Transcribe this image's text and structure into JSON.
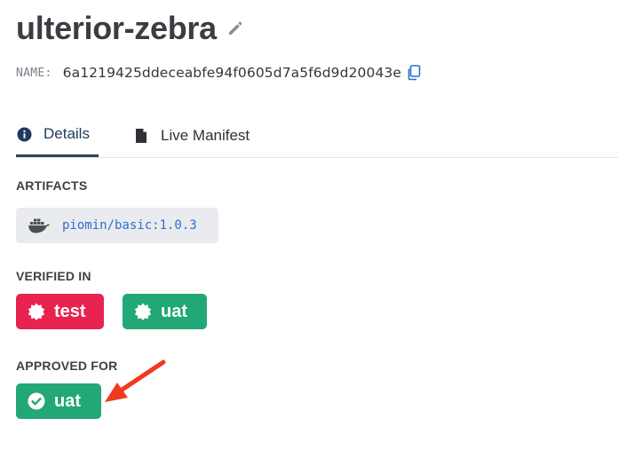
{
  "header": {
    "title": "ulterior-zebra",
    "name_label": "NAME:",
    "name_value": "6a1219425ddeceabfe94f0605d7a5f6d9d20043e"
  },
  "tabs": [
    {
      "label": "Details",
      "icon": "info-circle-icon",
      "active": true
    },
    {
      "label": "Live Manifest",
      "icon": "file-icon",
      "active": false
    }
  ],
  "artifacts": {
    "label": "ARTIFACTS",
    "items": [
      {
        "icon": "docker-icon",
        "text": "piomin/basic:1.0.3"
      }
    ]
  },
  "verified_in": {
    "label": "VERIFIED IN",
    "items": [
      {
        "name": "test",
        "icon": "badge-seal-icon",
        "color": "#e8234f"
      },
      {
        "name": "uat",
        "icon": "badge-seal-icon",
        "color": "#22a876"
      }
    ]
  },
  "approved_for": {
    "label": "APPROVED FOR",
    "items": [
      {
        "name": "uat",
        "icon": "check-circle-icon",
        "color": "#22a876"
      }
    ]
  },
  "colors": {
    "accent_link": "#2f6fcf",
    "danger": "#e8234f",
    "success": "#22a876",
    "annotation_arrow": "#ee3a1e"
  }
}
